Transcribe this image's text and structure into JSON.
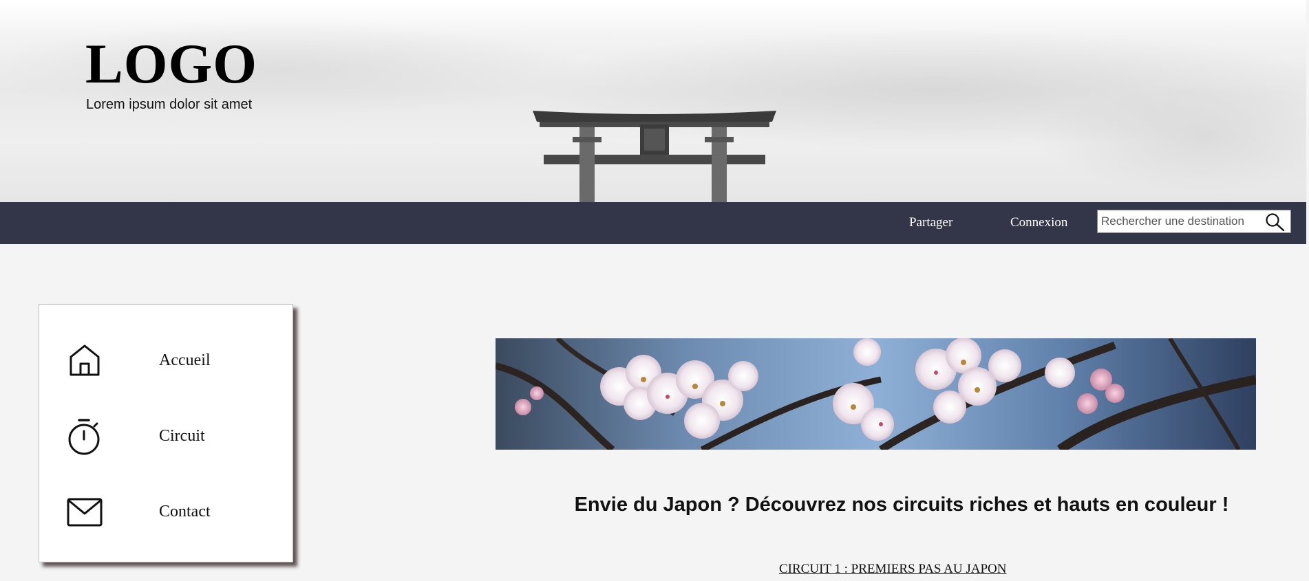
{
  "header": {
    "logo": "LOGO",
    "tagline": "Lorem ipsum dolor sit amet"
  },
  "nav": {
    "share_label": "Partager",
    "login_label": "Connexion",
    "search_placeholder": "Rechercher une destination"
  },
  "sidebar": {
    "items": [
      {
        "label": "Accueil",
        "icon": "home-icon"
      },
      {
        "label": "Circuit",
        "icon": "stopwatch-icon"
      },
      {
        "label": "Contact",
        "icon": "mail-icon"
      }
    ]
  },
  "main": {
    "headline": "Envie du Japon ? Découvrez nos circuits riches et hauts en couleur !",
    "circuit_link": "CIRCUIT 1 : PREMIERS PAS AU JAPON"
  },
  "colors": {
    "navbar": "#333548",
    "background": "#f4f4f4"
  }
}
